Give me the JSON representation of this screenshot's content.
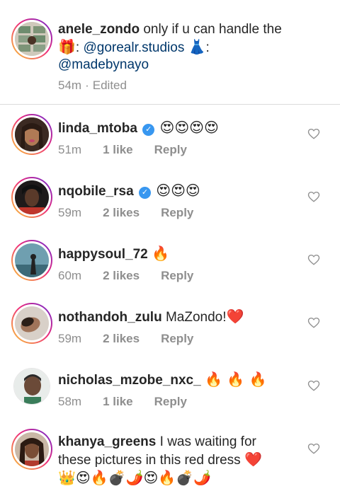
{
  "caption": {
    "username": "anele_zondo",
    "text_1": "only if u can handle the",
    "gift_emoji": "🎁",
    "colon_1": ":",
    "mention_1": "@gorealr.studios",
    "dress_emoji": "👗",
    "colon_2": ":",
    "mention_2": "@madebynayo",
    "time": "54m",
    "separator": "·",
    "edited": "Edited"
  },
  "comments": [
    {
      "username": "linda_mtoba",
      "verified": "✓",
      "text": "😍😍😍😍",
      "time": "51m",
      "likes": "1 like",
      "reply": "Reply"
    },
    {
      "username": "nqobile_rsa",
      "verified": "✓",
      "text": "😍😍😍",
      "time": "59m",
      "likes": "2 likes",
      "reply": "Reply"
    },
    {
      "username": "happysoul_72",
      "text": "🔥",
      "time": "60m",
      "likes": "2 likes",
      "reply": "Reply"
    },
    {
      "username": "nothandoh_zulu",
      "text": "MaZondo!",
      "emoji": "❤️",
      "time": "59m",
      "likes": "2 likes",
      "reply": "Reply"
    },
    {
      "username": "nicholas_mzobe_nxc_",
      "text": "🔥 🔥 🔥",
      "time": "58m",
      "likes": "1 like",
      "reply": "Reply"
    },
    {
      "username": "khanya_greens",
      "text": "I was waiting for these pictures in this red dress",
      "emoji": "❤️",
      "emoji_line": "👑😍🔥💣🌶️😍🔥💣🌶️"
    }
  ],
  "colors": {
    "text": "#262626",
    "muted": "#8e8e8e",
    "mention": "#00376b",
    "verified": "#3897f0"
  },
  "icons": {
    "like": "heart-outline-icon",
    "verified": "verified-badge-icon"
  }
}
